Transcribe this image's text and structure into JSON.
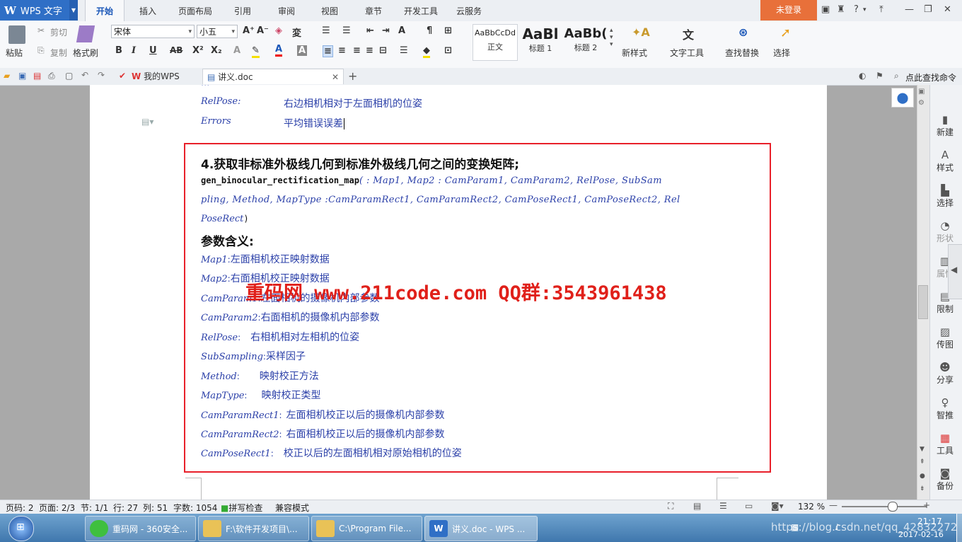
{
  "app": {
    "name": "WPS 文字"
  },
  "menu_tabs": [
    "开始",
    "插入",
    "页面布局",
    "引用",
    "审阅",
    "视图",
    "章节",
    "开发工具",
    "云服务"
  ],
  "login": "未登录",
  "ribbon": {
    "paste": "粘贴",
    "cut": "剪切",
    "copy": "复制",
    "format_painter": "格式刷",
    "font_name": "宋体",
    "font_size": "小五",
    "styles": [
      {
        "preview": "AaBbCcDd",
        "label": "正文"
      },
      {
        "preview": "AaBl",
        "label": "标题 1"
      },
      {
        "preview": "AaBb(",
        "label": "标题 2"
      }
    ],
    "new_style": "新样式",
    "text_tools": "文字工具",
    "find_replace": "查找替换",
    "select": "选择"
  },
  "tabs": {
    "my_wps": "我的WPS",
    "doc_tab": "讲义.doc",
    "search_cmd": "点此查找命令"
  },
  "document": {
    "top_cut": "...",
    "relpose_key": "RelPose:",
    "relpose_val": "右边相机相对于左面相机的位姿",
    "errors_key": "Errors",
    "errors_val": "平均错误误差",
    "heading": "4.获取非标准外极线几何到标准外极线几何之间的变换矩阵;",
    "func_name": "gen_binocular_rectification_map",
    "func_line1_params": "( :  Map1,  Map2  :  CamParam1,  CamParam2,  RelPose,  SubSam",
    "func_line2": "pling,  Method,  MapType  :CamParamRect1,  CamParamRect2,  CamPoseRect1,  CamPoseRect2,  Rel",
    "func_line3_it": "PoseRect",
    "func_line3_end": ")",
    "param_heading": "参数含义:",
    "params": [
      {
        "key": "Map1",
        "sep": ":",
        "desc": "左面相机校正映射数据"
      },
      {
        "key": "Map2",
        "sep": ":",
        "desc": "右面相机校正映射数据"
      },
      {
        "key": "CamParam1",
        "sep": ":",
        "desc": "左面相机的摄像机内部参数"
      },
      {
        "key": "CamParam2",
        "sep": ":",
        "desc": "右面相机的摄像机内部参数"
      },
      {
        "key": "RelPose",
        "sep": ":",
        "desc": "右相机相对左相机的位姿"
      },
      {
        "key": "SubSampling",
        "sep": ":",
        "desc": "采样因子"
      },
      {
        "key": "Method",
        "sep": ":",
        "desc": "映射校正方法"
      },
      {
        "key": "MapType",
        "sep": ":",
        "desc": "映射校正类型"
      },
      {
        "key": "CamParamRect1",
        "sep": ":",
        "desc": "左面相机校正以后的摄像机内部参数"
      },
      {
        "key": "CamParamRect2",
        "sep": ":",
        "desc": "右面相机校正以后的摄像机内部参数"
      },
      {
        "key": "CamPoseRect1",
        "sep": ":",
        "desc": "校正以后的左面相机相对原始相机的位姿"
      }
    ],
    "watermark": "重码网 www.211code.com  QQ群:3543961438"
  },
  "right_panel": [
    {
      "icon": "new-icon",
      "label": "新建"
    },
    {
      "icon": "style-icon",
      "label": "样式"
    },
    {
      "icon": "select-icon",
      "label": "选择"
    },
    {
      "icon": "shape-icon",
      "label": "形状"
    },
    {
      "icon": "property-icon",
      "label": "属性"
    },
    {
      "icon": "restrict-icon",
      "label": "限制"
    },
    {
      "icon": "image-icon",
      "label": "传图"
    },
    {
      "icon": "share-icon",
      "label": "分享"
    },
    {
      "icon": "smart-icon",
      "label": "智推"
    },
    {
      "icon": "tools-icon",
      "label": "工具"
    },
    {
      "icon": "backup-icon",
      "label": "备份"
    }
  ],
  "status": {
    "page_num": "页码: 2",
    "pages": "页面: 2/3",
    "section": "节: 1/1",
    "row": "行: 27",
    "col": "列: 51",
    "words": "字数: 1054",
    "spell": "拼写检查",
    "compat": "兼容模式",
    "zoom": "132 %"
  },
  "taskbar": {
    "items": [
      "重码网 - 360安全...",
      "F:\\软件开发项目\\...",
      "C:\\Program File...",
      "讲义.doc - WPS ..."
    ],
    "time": "21:17",
    "date": "2017-02-16",
    "url_overlay": "https://blog.csdn.net/qq_42832272"
  },
  "colors": {
    "accent": "#2f6fc6",
    "login": "#e8703a",
    "watermark": "#e0201a",
    "box": "#e8202a",
    "doc_text": "#2a3fa8"
  }
}
